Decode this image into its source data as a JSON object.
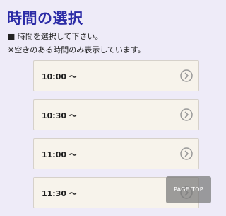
{
  "header": {
    "title": "時間の選択"
  },
  "instructions": {
    "line1": "■ 時間を選択して下さい。",
    "line2": "※空きのある時間のみ表示しています。"
  },
  "slots": [
    {
      "label": "10:00 ～",
      "icon": "chevron-right-circle-icon"
    },
    {
      "label": "10:30 ～",
      "icon": "chevron-right-circle-icon"
    },
    {
      "label": "11:00 ～",
      "icon": "chevron-right-circle-icon"
    },
    {
      "label": "11:30 ～",
      "icon": "chevron-right-circle-icon"
    }
  ],
  "page_top": {
    "label": "PAGE TOP"
  },
  "colors": {
    "background": "#eeebf8",
    "title": "#2b2ba6",
    "slot_background": "#f7f3eb",
    "arrow": "#9a9a9a"
  }
}
